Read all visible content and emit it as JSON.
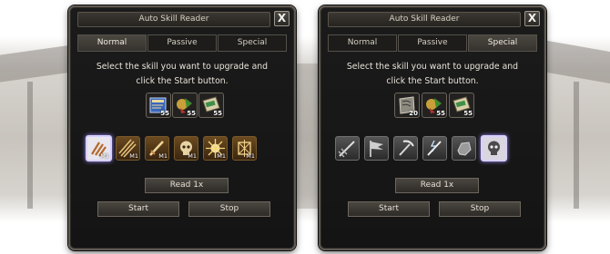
{
  "left_window": {
    "title": "Auto Skill Reader",
    "close_label": "X",
    "tabs": [
      {
        "label": "Normal",
        "active": true
      },
      {
        "label": "Passive",
        "active": false
      },
      {
        "label": "Special",
        "active": false
      }
    ],
    "instruction": {
      "line1": "Select the skill you want to upgrade and",
      "line2": "click the Start button."
    },
    "readers": [
      {
        "icon": "blue-book-icon",
        "count": "55"
      },
      {
        "icon": "herb-bundle-icon",
        "count": "55"
      },
      {
        "icon": "green-scroll-icon",
        "count": "55"
      }
    ],
    "skills": [
      {
        "icon": "claw-strike-icon",
        "level": "M1",
        "selected": true
      },
      {
        "icon": "triple-blade-icon",
        "level": "M1",
        "selected": false
      },
      {
        "icon": "sword-icon",
        "level": "M1",
        "selected": false
      },
      {
        "icon": "skull-icon",
        "level": "M1",
        "selected": false
      },
      {
        "icon": "radiant-burst-icon",
        "level": "M1",
        "selected": false
      },
      {
        "icon": "rune-sigil-icon",
        "level": "M1",
        "selected": false
      }
    ],
    "read_button": "Read 1x",
    "start_button": "Start",
    "stop_button": "Stop"
  },
  "right_window": {
    "title": "Auto Skill Reader",
    "close_label": "X",
    "tabs": [
      {
        "label": "Normal",
        "active": false
      },
      {
        "label": "Passive",
        "active": false
      },
      {
        "label": "Special",
        "active": true
      }
    ],
    "instruction": {
      "line1": "Select the skill you want to upgrade and",
      "line2": "click the Start button."
    },
    "readers": [
      {
        "icon": "stone-tablet-icon",
        "count": "20"
      },
      {
        "icon": "herb-bundle-icon",
        "count": "55"
      },
      {
        "icon": "green-scroll-icon",
        "count": "55"
      }
    ],
    "skills": [
      {
        "icon": "spear-thrust-icon",
        "level": "",
        "selected": false
      },
      {
        "icon": "banner-flag-icon",
        "level": "",
        "selected": false
      },
      {
        "icon": "pickaxe-icon",
        "level": "",
        "selected": false
      },
      {
        "icon": "lightning-sword-icon",
        "level": "",
        "selected": false
      },
      {
        "icon": "rock-throw-icon",
        "level": "",
        "selected": false
      },
      {
        "icon": "skull-icon",
        "level": "",
        "selected": true
      }
    ],
    "read_button": "Read 1x",
    "start_button": "Start",
    "stop_button": "Stop"
  }
}
